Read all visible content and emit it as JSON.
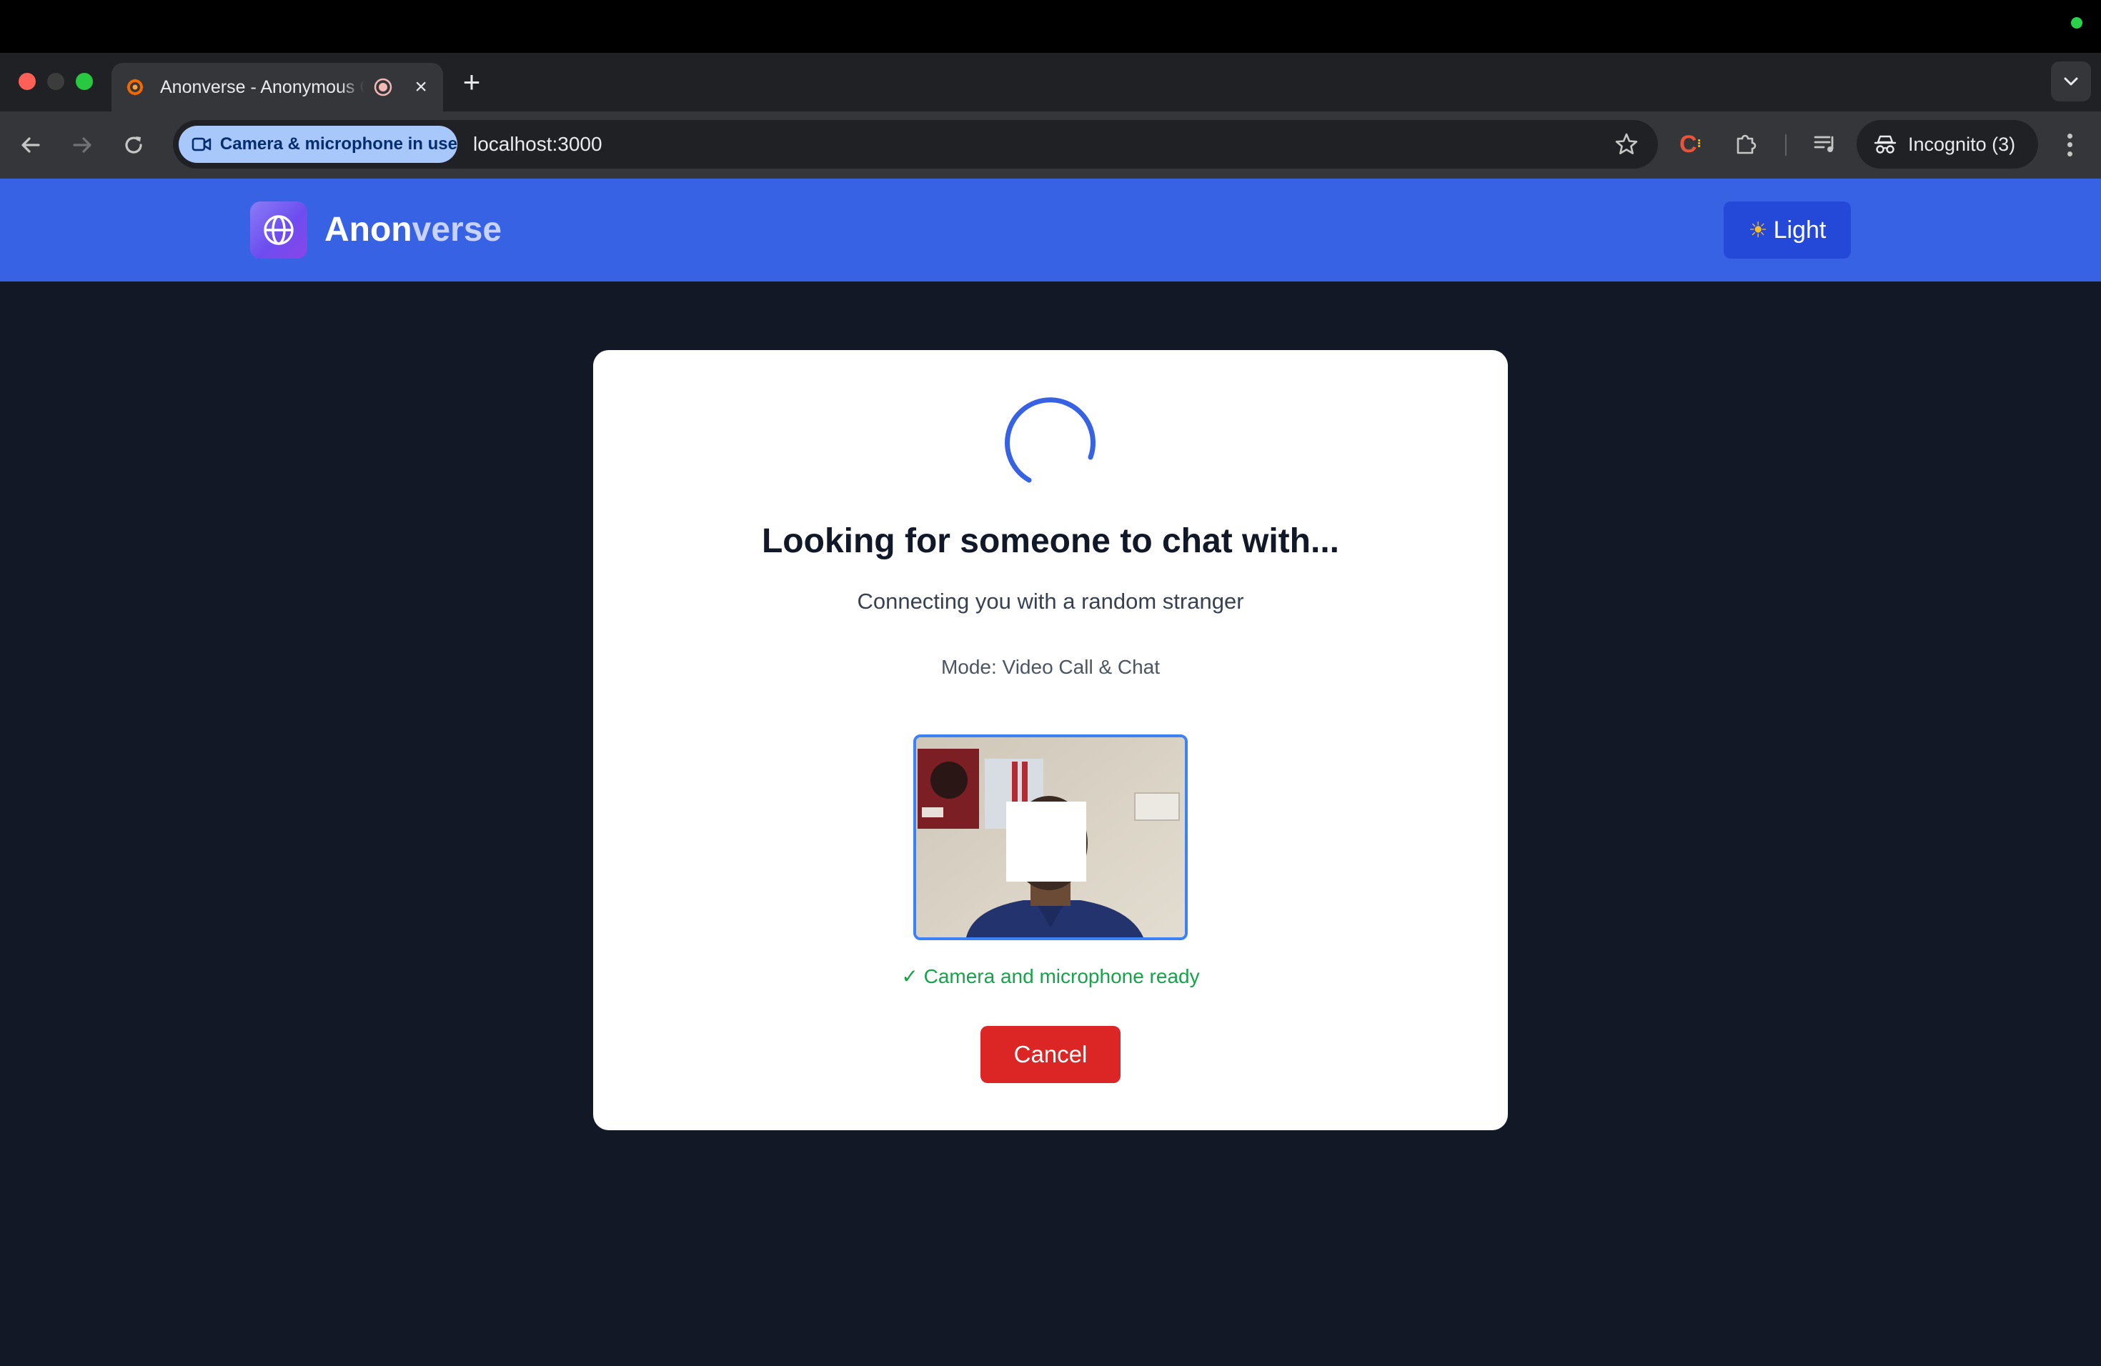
{
  "browser": {
    "tab_title": "Anonverse - Anonymous Chat",
    "permission_chip": "Camera & microphone in use",
    "url": "localhost:3000",
    "extension_label": "C",
    "profile_label": "Incognito (3)"
  },
  "header": {
    "brand_part1": "Anon",
    "brand_part2": "verse",
    "theme_icon": "☀",
    "theme_label": "Light"
  },
  "card": {
    "title": "Looking for someone to chat with...",
    "subtitle": "Connecting you with a random stranger",
    "mode": "Mode: Video Call & Chat",
    "ready_status": "✓ Camera and microphone ready",
    "cancel_label": "Cancel"
  },
  "colors": {
    "header_bg": "#3762e4",
    "page_bg": "#121826",
    "cancel_bg": "#dc2626",
    "ready_text": "#16a34a",
    "spinner": "#3762e4"
  }
}
